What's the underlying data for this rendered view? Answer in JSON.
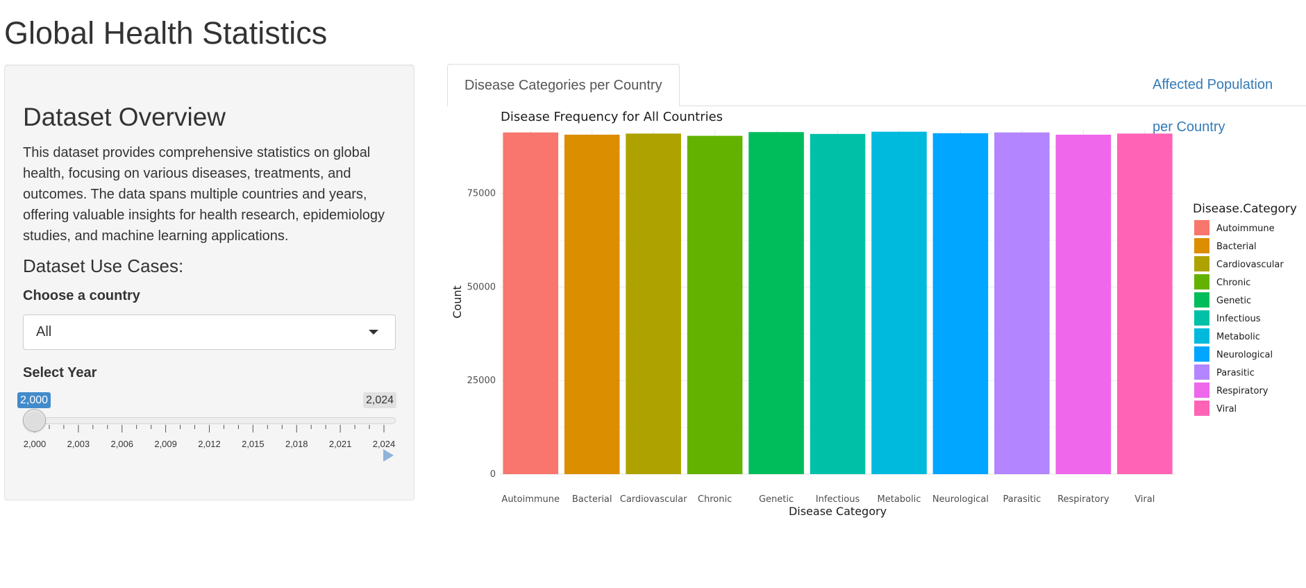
{
  "app": {
    "title": "Global Health Statistics"
  },
  "sidebar": {
    "heading": "Dataset Overview",
    "overview": "This dataset provides comprehensive statistics on global health, focusing on various diseases, treatments, and outcomes. The data spans multiple countries and years, offering valuable insights for health research, epidemiology studies, and machine learning applications.",
    "use_cases_heading": "Dataset Use Cases:",
    "country_label": "Choose a country",
    "country_value": "All",
    "year_label": "Select Year",
    "year_from_label": "2,000",
    "year_to_label": "2,024",
    "year_range": [
      2000,
      2024
    ],
    "year_ticks": [
      "2,000",
      "2,003",
      "2,006",
      "2,009",
      "2,012",
      "2,015",
      "2,018",
      "2,021",
      "2,024"
    ]
  },
  "tabs": [
    {
      "label": "Disease Categories per Country",
      "active": true
    },
    {
      "label": "Affected Population per Country",
      "active": false
    }
  ],
  "chart_data": {
    "type": "bar",
    "title": "Disease Frequency for All Countries",
    "xlabel": "Disease Category",
    "ylabel": "Count",
    "legend_title": "Disease.Category",
    "legend_position": "right",
    "grid": true,
    "ylim": [
      0,
      92000
    ],
    "yticks": [
      0,
      25000,
      50000,
      75000
    ],
    "categories": [
      "Autoimmune",
      "Bacterial",
      "Cardiovascular",
      "Chronic",
      "Genetic",
      "Infectious",
      "Metabolic",
      "Neurological",
      "Parasitic",
      "Respiratory",
      "Viral"
    ],
    "values": [
      91300,
      90700,
      91000,
      90400,
      91400,
      90900,
      91500,
      91100,
      91300,
      90700,
      91000
    ],
    "colors": [
      "#F8766D",
      "#DB8E00",
      "#AEA200",
      "#64B200",
      "#00BD5C",
      "#00C1A7",
      "#00BADE",
      "#00A6FF",
      "#B385FF",
      "#EF67EB",
      "#FF63B6"
    ]
  }
}
